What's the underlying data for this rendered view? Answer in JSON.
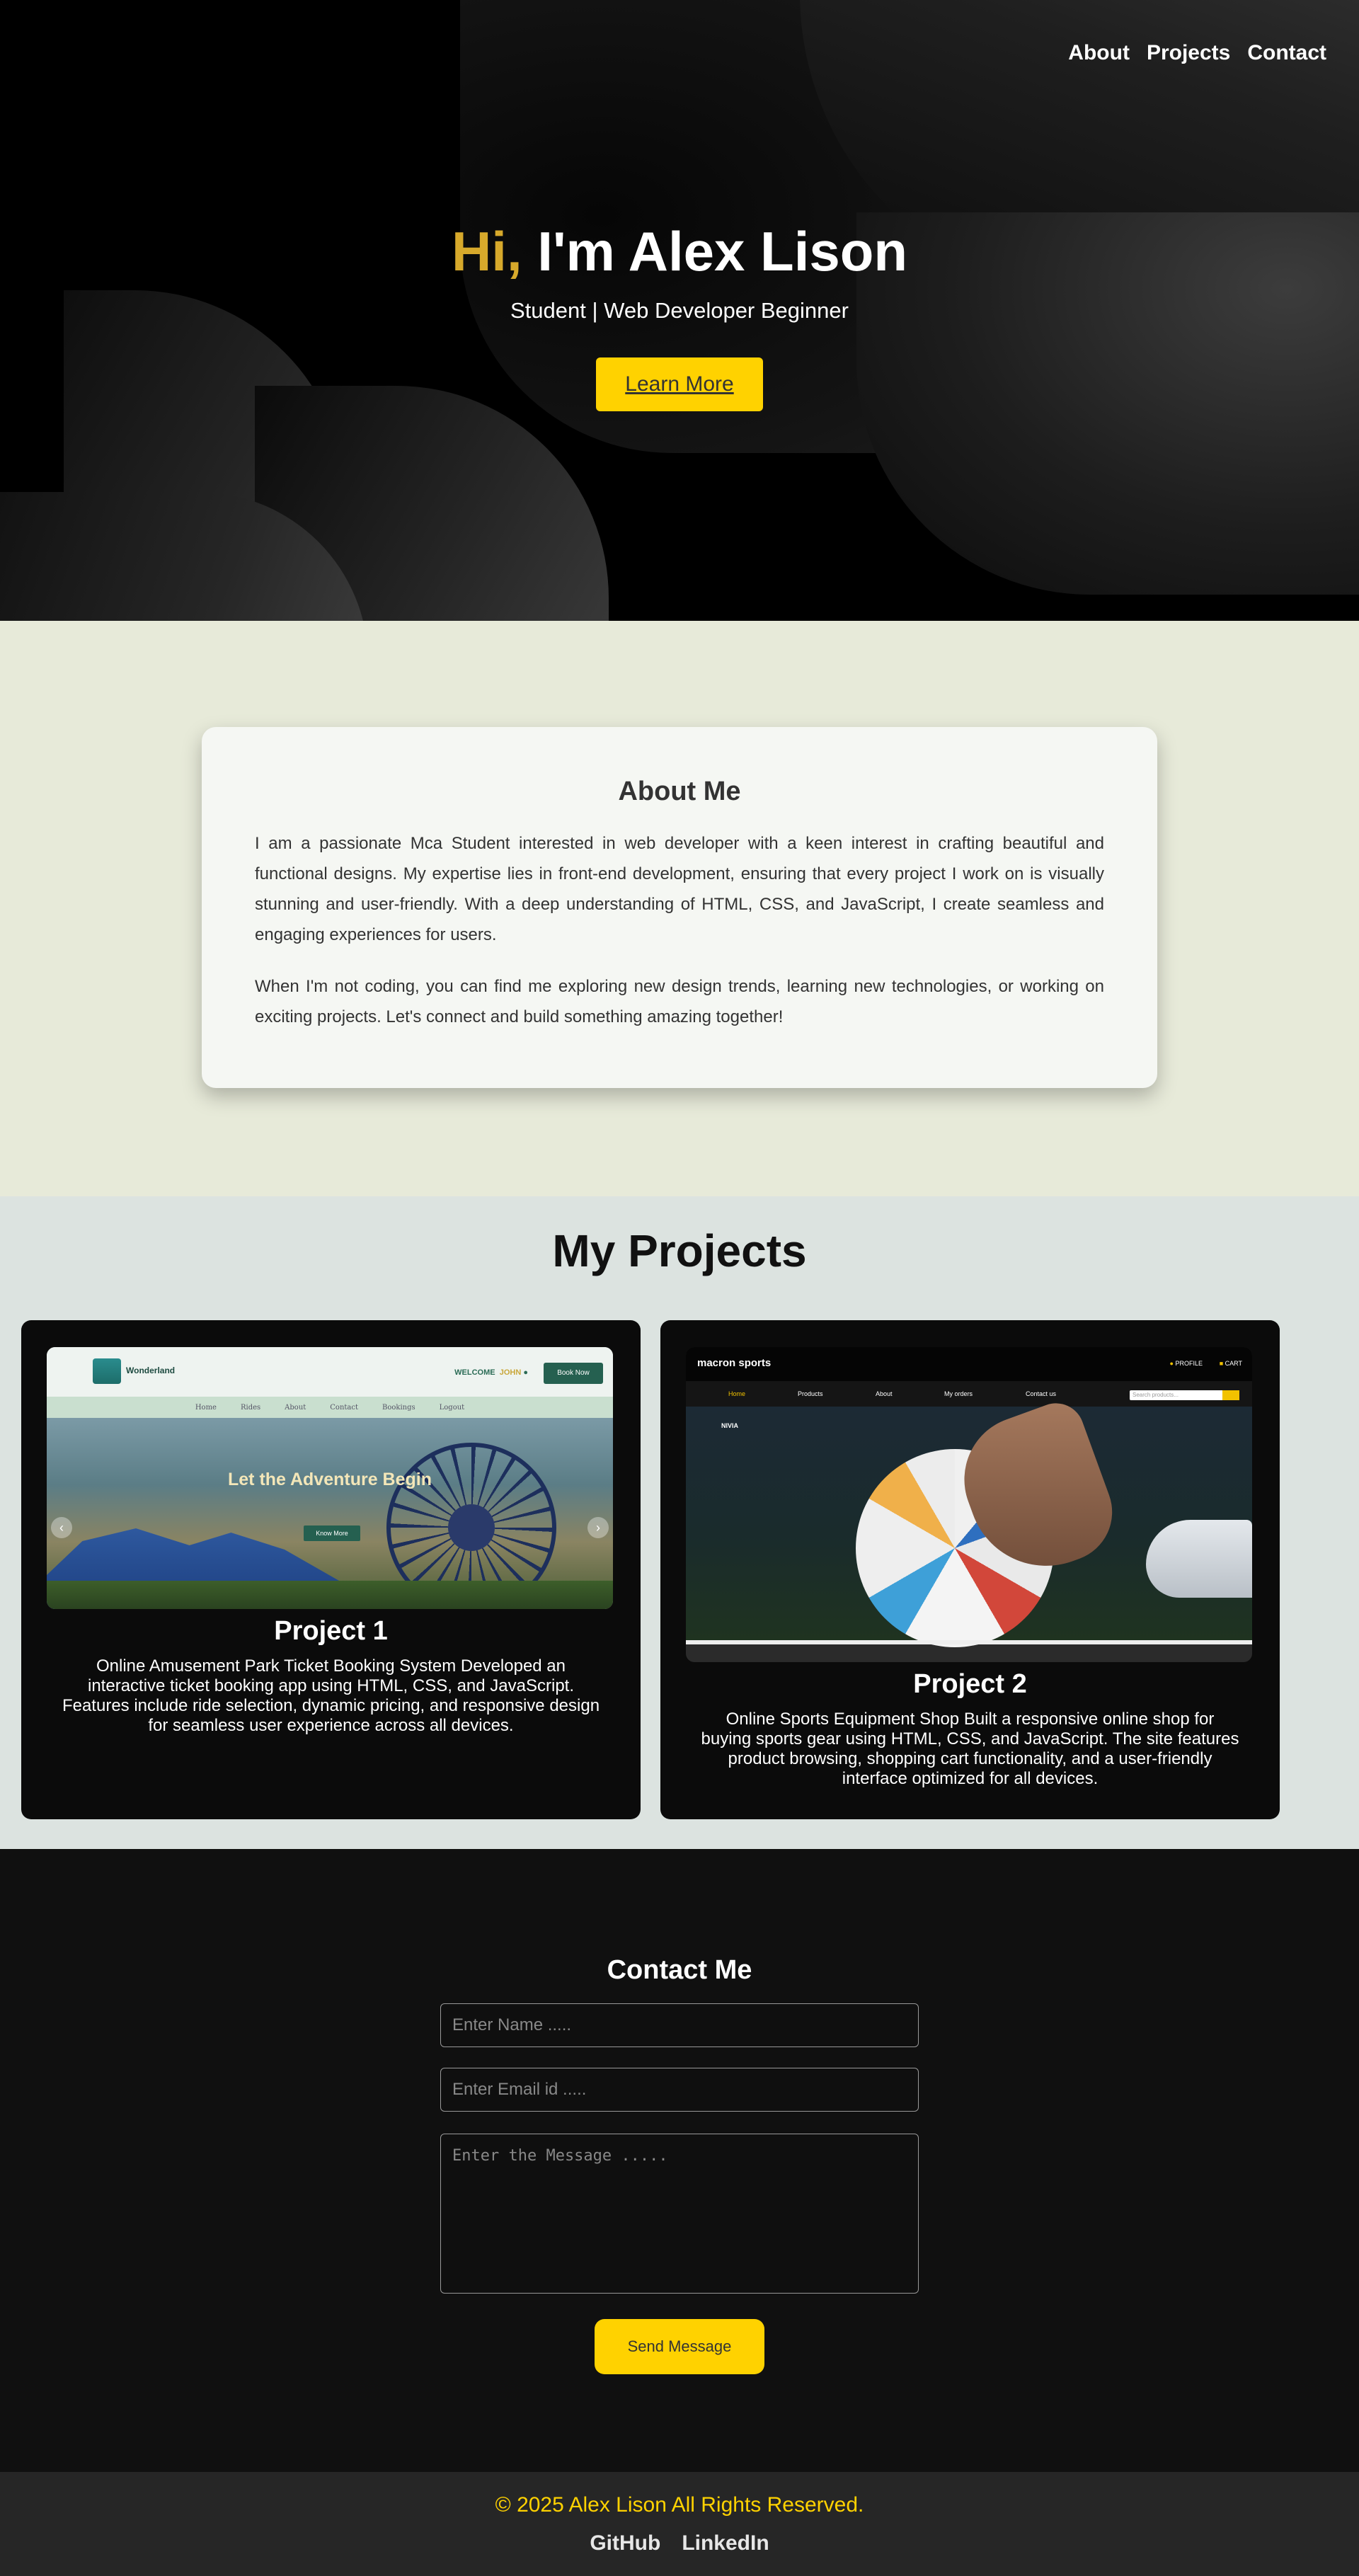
{
  "nav": {
    "items": [
      "About",
      "Projects",
      "Contact"
    ]
  },
  "hero": {
    "greeting": "Hi,",
    "name": "I'm Alex Lison",
    "subtitle": "Student | Web Developer Beginner",
    "button": "Learn More"
  },
  "about": {
    "title": "About Me",
    "paragraphs": [
      "I am a passionate Mca Student interested in web developer with a keen interest in crafting beautiful and functional designs. My expertise lies in front-end development, ensuring that every project I work on is visually stunning and user-friendly. With a deep understanding of HTML, CSS, and JavaScript, I create seamless and engaging experiences for users.",
      "When I'm not coding, you can find me exploring new design trends, learning new technologies, or working on exciting projects. Let's connect and build something amazing together!"
    ]
  },
  "projects": {
    "title": "My Projects",
    "items": [
      {
        "title": "Project 1",
        "description": "Online Amusement Park Ticket Booking System Developed an interactive ticket booking app using HTML, CSS, and JavaScript. Features include ride selection, dynamic pricing, and responsive design for seamless user experience across all devices.",
        "preview": {
          "brand": "Wonderland",
          "welcome": "WELCOME",
          "user": "JOHN",
          "book_button": "Book Now",
          "menu": [
            "Home",
            "Rides",
            "About",
            "Contact",
            "Bookings",
            "Logout"
          ],
          "banner_text": "Let the Adventure Begin",
          "banner_button": "Know More"
        }
      },
      {
        "title": "Project 2",
        "description": "Online Sports Equipment Shop Built a responsive online shop for buying sports gear using HTML, CSS, and JavaScript. The site features product browsing, shopping cart functionality, and a user-friendly interface optimized for all devices.",
        "preview": {
          "brand": "macron sports",
          "profile": "PROFILE",
          "cart": "CART",
          "menu": [
            "Home",
            "Products",
            "About",
            "My orders",
            "Contact us"
          ],
          "search_placeholder": "Search products...",
          "hero_logo": "NIVIA"
        }
      }
    ]
  },
  "contact": {
    "title": "Contact Me",
    "name_placeholder": "Enter Name .....",
    "email_placeholder": "Enter Email id .....",
    "message_placeholder": "Enter the Message .....",
    "button": "Send Message"
  },
  "footer": {
    "copyright": "© 2025 Alex Lison All Rights Reserved.",
    "links": [
      "GitHub",
      "LinkedIn"
    ]
  },
  "colors": {
    "accent_yellow": "#ffd200",
    "greeting_gold": "#d7a92b",
    "about_bg": "#e7ead9",
    "projects_bg": "#dce3e0",
    "dark_bg": "#101010"
  }
}
